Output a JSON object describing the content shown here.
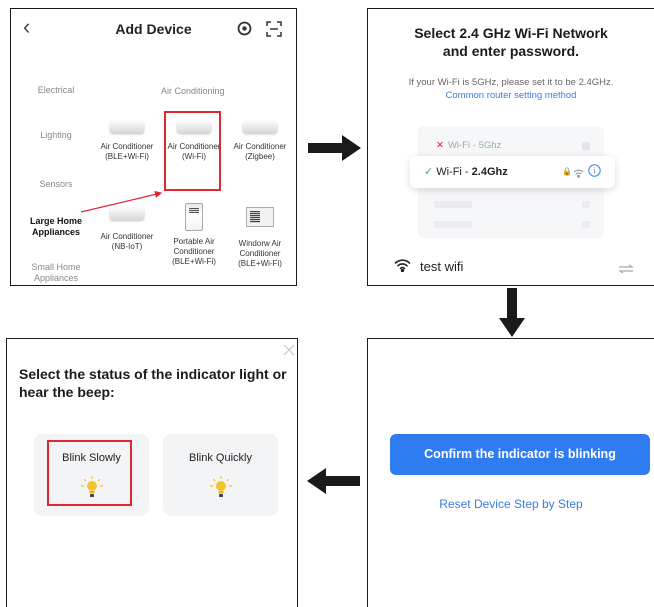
{
  "add_device": {
    "title": "Add Device",
    "categories": [
      "Electrical",
      "Lighting",
      "Sensors",
      "Large Home Appliances",
      "Small Home Appliances"
    ],
    "section_title": "Air Conditioning",
    "devices": [
      {
        "name": "Air Conditioner (BLE+Wi-Fi)"
      },
      {
        "name": "Air Conditioner (Wi-Fi)"
      },
      {
        "name": "Air Conditioner (Zigbee)"
      },
      {
        "name": "Air Conditioner (NB-IoT)"
      },
      {
        "name": "Portable Air Conditioner (BLE+Wi-Fi)"
      },
      {
        "name": "Windorw Air Conditioner (BLE+Wi-Fi)"
      }
    ]
  },
  "wifi_select": {
    "title_line1": "Select 2.4 GHz Wi-Fi Network",
    "title_line2": "and enter password.",
    "subtitle": "If your Wi-Fi is 5GHz, please set it to be 2.4GHz.",
    "link": "Common router setting method",
    "net_5g": "Wi-Fi - 5Ghz",
    "net_24_prefix": "Wi-Fi - ",
    "net_24_bold": "2.4Ghz",
    "current_wifi": "test wifi"
  },
  "indicator": {
    "title": "Select the status of the indicator light or hear the beep:",
    "slow": "Blink Slowly",
    "quick": "Blink Quickly"
  },
  "confirm": {
    "button": "Confirm the indicator is blinking",
    "reset": "Reset Device Step by Step"
  },
  "colors": {
    "accent_blue": "#2f7cf0",
    "highlight_red": "#e0272f",
    "bulb_yellow": "#f4c430"
  }
}
